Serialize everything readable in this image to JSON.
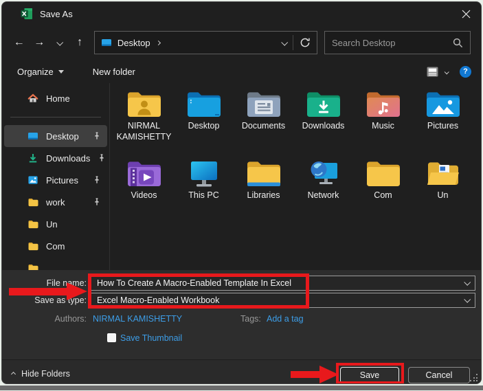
{
  "window": {
    "title": "Save As"
  },
  "nav": {
    "breadcrumb_location": "Desktop",
    "search_placeholder": "Search Desktop"
  },
  "toolbar": {
    "organize_label": "Organize",
    "new_folder_label": "New folder",
    "help_label": "?"
  },
  "sidebar": {
    "items": [
      {
        "label": "Home",
        "icon": "home-icon",
        "pinned": false,
        "selected": false
      },
      {
        "label": "Desktop",
        "icon": "monitor-icon",
        "pinned": true,
        "selected": true
      },
      {
        "label": "Downloads",
        "icon": "download-icon",
        "pinned": true,
        "selected": false
      },
      {
        "label": "Pictures",
        "icon": "picture-icon",
        "pinned": true,
        "selected": false
      },
      {
        "label": "work",
        "icon": "folder-icon",
        "pinned": true,
        "selected": false
      },
      {
        "label": "Un",
        "icon": "folder-icon",
        "pinned": false,
        "selected": false
      },
      {
        "label": "Com",
        "icon": "folder-icon",
        "pinned": false,
        "selected": false
      }
    ]
  },
  "files": {
    "items": [
      {
        "label": "NIRMAL KAMISHETTY",
        "icon": "user-folder-icon"
      },
      {
        "label": "Desktop",
        "icon": "desktop-folder-icon"
      },
      {
        "label": "Documents",
        "icon": "documents-folder-icon"
      },
      {
        "label": "Downloads",
        "icon": "downloads-folder-icon"
      },
      {
        "label": "Music",
        "icon": "music-folder-icon"
      },
      {
        "label": "Pictures",
        "icon": "pictures-folder-icon"
      },
      {
        "label": "Videos",
        "icon": "videos-folder-icon"
      },
      {
        "label": "This PC",
        "icon": "monitor-icon"
      },
      {
        "label": "Libraries",
        "icon": "libraries-folder-icon"
      },
      {
        "label": "Network",
        "icon": "network-icon"
      },
      {
        "label": "Com",
        "icon": "folder-icon"
      },
      {
        "label": "Un",
        "icon": "open-folder-doc-icon"
      }
    ]
  },
  "form": {
    "file_name_label": "File name:",
    "file_name_value": "How To Create A Macro-Enabled Template In Excel",
    "save_type_label": "Save as type:",
    "save_type_value": "Excel Macro-Enabled Workbook",
    "authors_label": "Authors:",
    "authors_value": "NIRMAL KAMISHETTY",
    "tags_label": "Tags:",
    "add_tag_label": "Add a tag",
    "save_thumbnail_label": "Save Thumbnail"
  },
  "footer": {
    "hide_folders_label": "Hide Folders",
    "save_label": "Save",
    "cancel_label": "Cancel"
  },
  "colors": {
    "annotation_red": "#e8191c",
    "link_blue": "#3d9ee8",
    "help_blue": "#1178d2",
    "selection_gray": "#3f3f3f",
    "window_bg": "#1f1f1f"
  }
}
